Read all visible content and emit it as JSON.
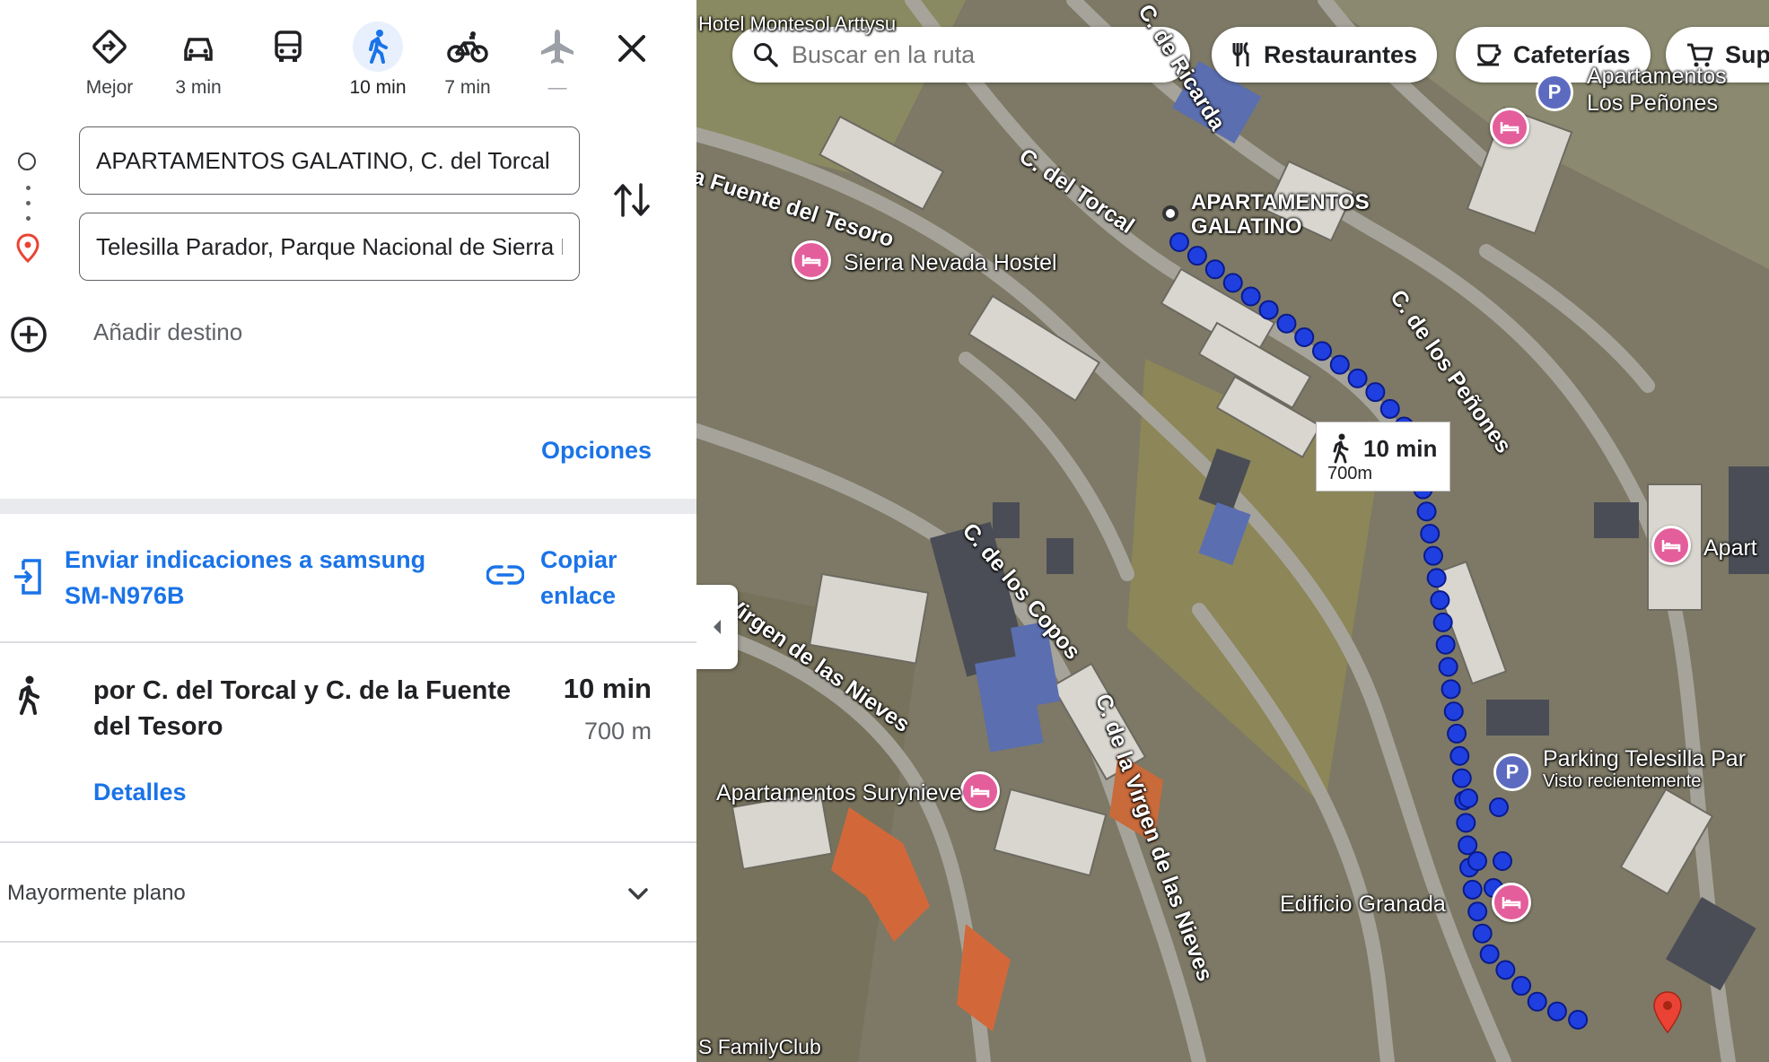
{
  "travel_modes": [
    {
      "name": "best",
      "label": "Mejor"
    },
    {
      "name": "car",
      "label": "3 min"
    },
    {
      "name": "transit",
      "label": ""
    },
    {
      "name": "walk",
      "label": "10 min",
      "active": true
    },
    {
      "name": "bike",
      "label": "7 min"
    },
    {
      "name": "flight",
      "label": "—"
    }
  ],
  "origin": {
    "value": "APARTAMENTOS GALATINO, C. del Torcal"
  },
  "destination": {
    "value": "Telesilla Parador, Parque Nacional de Sierra Nevada"
  },
  "add_destination": "Añadir destino",
  "options_label": "Opciones",
  "send_directions": "Enviar indicaciones a samsung SM-N976B",
  "copy_link": "Copiar enlace",
  "route": {
    "description": "por C. del Torcal y C. de la Fuente del Tesoro",
    "time": "10 min",
    "distance": "700 m",
    "details_label": "Detalles"
  },
  "terrain": "Mayormente plano",
  "map": {
    "search_placeholder": "Buscar en la ruta",
    "chips": {
      "restaurants": "Restaurantes",
      "cafes": "Cafeterías",
      "super": "Supe"
    },
    "callout": {
      "time": "10 min",
      "distance": "700m"
    },
    "streets": {
      "torcal": "C. del Torcal",
      "fuente": "la Fuente del Tesoro",
      "ricarda": "C. de Ricarda",
      "penones": "C. de los Peñones",
      "copos": "C. de los Copos",
      "virgen_nieves": "Virgen de las Nieves",
      "c_virgen_nieves": "C. de la Virgen de las Nieves"
    },
    "places": {
      "galatino": "APARTAMENTOS\nGALATINO",
      "hostel": "Sierra Nevada Hostel",
      "surynieve": "Apartamentos Surynieve",
      "granada": "Edificio Granada",
      "parking_name": "Parking Telesilla Par",
      "parking_sub": "Visto recientemente",
      "penones_apart": "Apartamentos\nLos Peñones",
      "apart_right": "Apart",
      "hotel_top": "Hotel Montesol Arttysu",
      "family": "S FamilyClub"
    },
    "accent": "#1a73e8",
    "route_dot_color": "#1f3fe0"
  }
}
